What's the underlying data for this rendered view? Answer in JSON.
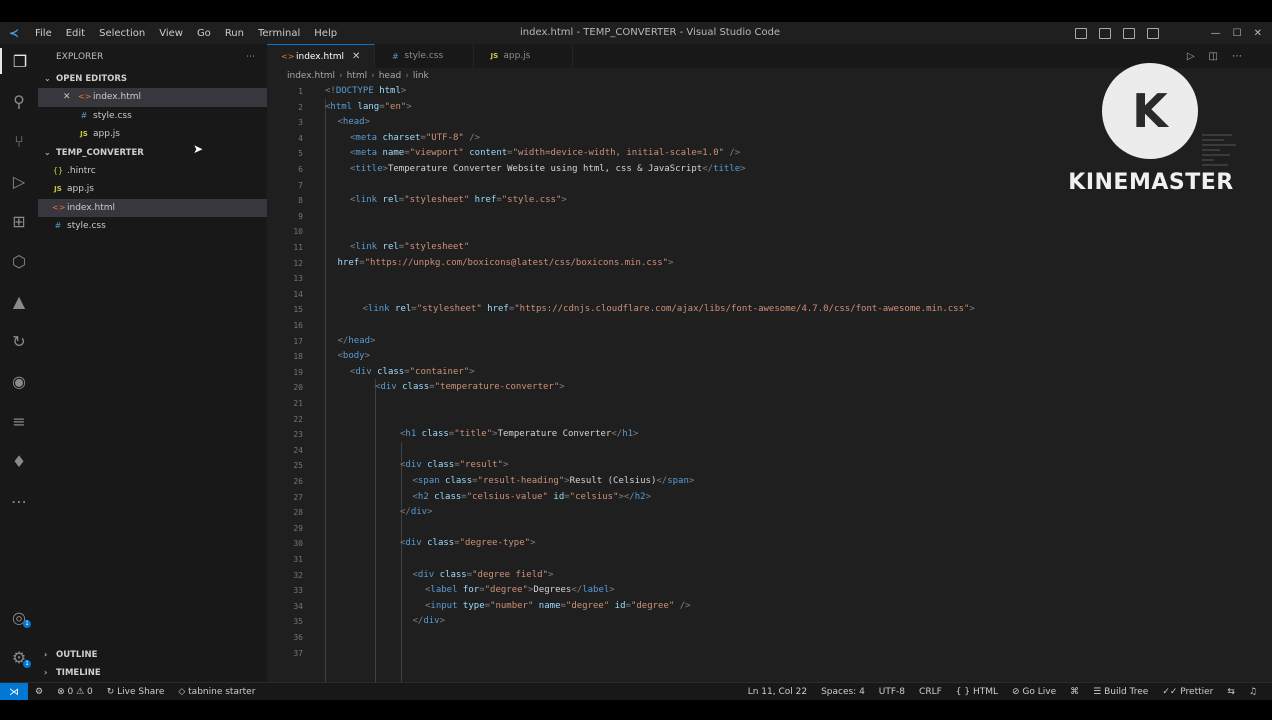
{
  "menu": [
    "File",
    "Edit",
    "Selection",
    "View",
    "Go",
    "Run",
    "Terminal",
    "Help"
  ],
  "window_title": "index.html - TEMP_CONVERTER - Visual Studio Code",
  "sidebar": {
    "title": "EXPLORER",
    "open_editors_title": "OPEN EDITORS",
    "open_editors": [
      "index.html",
      "style.css",
      "app.js"
    ],
    "folder_title": "TEMP_CONVERTER",
    "files": [
      ".hintrc",
      "app.js",
      "index.html",
      "style.css"
    ],
    "outline_title": "OUTLINE",
    "timeline_title": "TIMELINE"
  },
  "tabs": [
    {
      "label": "index.html",
      "active": true
    },
    {
      "label": "style.css",
      "active": false
    },
    {
      "label": "app.js",
      "active": false
    }
  ],
  "breadcrumb": [
    "index.html",
    "html",
    "head",
    "link"
  ],
  "code_lines": [
    {
      "n": "1",
      "indent": 0,
      "parts": [
        [
          "p",
          "<!"
        ],
        [
          "t",
          "DOCTYPE"
        ],
        [
          "a",
          " html"
        ],
        [
          "p",
          ">"
        ]
      ]
    },
    {
      "n": "2",
      "indent": 0,
      "parts": [
        [
          "p",
          "<"
        ],
        [
          "t",
          "html"
        ],
        [
          "a",
          " lang"
        ],
        [
          "p",
          "="
        ],
        [
          "s",
          "\"en\""
        ],
        [
          "p",
          ">"
        ]
      ]
    },
    {
      "n": "3",
      "indent": 1,
      "parts": [
        [
          "p",
          "<"
        ],
        [
          "t",
          "head"
        ],
        [
          "p",
          ">"
        ]
      ]
    },
    {
      "n": "4",
      "indent": 2,
      "parts": [
        [
          "p",
          "<"
        ],
        [
          "t",
          "meta"
        ],
        [
          "a",
          " charset"
        ],
        [
          "p",
          "="
        ],
        [
          "s",
          "\"UTF-8\""
        ],
        [
          "p",
          " />"
        ]
      ]
    },
    {
      "n": "5",
      "indent": 2,
      "parts": [
        [
          "p",
          "<"
        ],
        [
          "t",
          "meta"
        ],
        [
          "a",
          " name"
        ],
        [
          "p",
          "="
        ],
        [
          "s",
          "\"viewport\""
        ],
        [
          "a",
          " content"
        ],
        [
          "p",
          "="
        ],
        [
          "s",
          "\"width=device-width, initial-scale=1.0\""
        ],
        [
          "p",
          " />"
        ]
      ]
    },
    {
      "n": "6",
      "indent": 2,
      "parts": [
        [
          "p",
          "<"
        ],
        [
          "t",
          "title"
        ],
        [
          "p",
          ">"
        ],
        [
          "x",
          "Temperature Converter Website using html, css & JavaScript"
        ],
        [
          "p",
          "</"
        ],
        [
          "t",
          "title"
        ],
        [
          "p",
          ">"
        ]
      ]
    },
    {
      "n": "7",
      "indent": 0,
      "parts": []
    },
    {
      "n": "8",
      "indent": 2,
      "parts": [
        [
          "p",
          "<"
        ],
        [
          "t",
          "link"
        ],
        [
          "a",
          " rel"
        ],
        [
          "p",
          "="
        ],
        [
          "s",
          "\"stylesheet\""
        ],
        [
          "a",
          " href"
        ],
        [
          "p",
          "="
        ],
        [
          "s",
          "\"style.css\""
        ],
        [
          "p",
          ">"
        ]
      ]
    },
    {
      "n": "9",
      "indent": 0,
      "parts": []
    },
    {
      "n": "10",
      "indent": 0,
      "parts": []
    },
    {
      "n": "11",
      "indent": 2,
      "parts": [
        [
          "p",
          "<"
        ],
        [
          "t",
          "link"
        ],
        [
          "a",
          " rel"
        ],
        [
          "p",
          "="
        ],
        [
          "s",
          "\"stylesheet\""
        ]
      ]
    },
    {
      "n": "12",
      "indent": 1,
      "parts": [
        [
          "a",
          "href"
        ],
        [
          "p",
          "="
        ],
        [
          "s",
          "\"https://unpkg.com/boxicons@latest/css/boxicons.min.css\""
        ],
        [
          "p",
          ">"
        ]
      ]
    },
    {
      "n": "13",
      "indent": 0,
      "parts": []
    },
    {
      "n": "14",
      "indent": 0,
      "parts": []
    },
    {
      "n": "15",
      "indent": 3,
      "parts": [
        [
          "p",
          "<"
        ],
        [
          "t",
          "link"
        ],
        [
          "a",
          " rel"
        ],
        [
          "p",
          "="
        ],
        [
          "s",
          "\"stylesheet\""
        ],
        [
          "a",
          " href"
        ],
        [
          "p",
          "="
        ],
        [
          "s",
          "\"https://cdnjs.cloudflare.com/ajax/libs/font-awesome/4.7.0/css/font-awesome.min.css\""
        ],
        [
          "p",
          ">"
        ]
      ]
    },
    {
      "n": "16",
      "indent": 0,
      "parts": []
    },
    {
      "n": "17",
      "indent": 1,
      "parts": [
        [
          "p",
          "</"
        ],
        [
          "t",
          "head"
        ],
        [
          "p",
          ">"
        ]
      ]
    },
    {
      "n": "18",
      "indent": 1,
      "parts": [
        [
          "p",
          "<"
        ],
        [
          "t",
          "body"
        ],
        [
          "p",
          ">"
        ]
      ]
    },
    {
      "n": "19",
      "indent": 2,
      "parts": [
        [
          "p",
          "<"
        ],
        [
          "t",
          "div"
        ],
        [
          "a",
          " class"
        ],
        [
          "p",
          "="
        ],
        [
          "s",
          "\"container\""
        ],
        [
          "p",
          ">"
        ]
      ]
    },
    {
      "n": "20",
      "indent": 4,
      "parts": [
        [
          "p",
          "<"
        ],
        [
          "t",
          "div"
        ],
        [
          "a",
          " class"
        ],
        [
          "p",
          "="
        ],
        [
          "s",
          "\"temperature-converter\""
        ],
        [
          "p",
          ">"
        ]
      ]
    },
    {
      "n": "21",
      "indent": 0,
      "parts": []
    },
    {
      "n": "22",
      "indent": 0,
      "parts": []
    },
    {
      "n": "23",
      "indent": 6,
      "parts": [
        [
          "p",
          "<"
        ],
        [
          "t",
          "h1"
        ],
        [
          "a",
          " class"
        ],
        [
          "p",
          "="
        ],
        [
          "s",
          "\"title\""
        ],
        [
          "p",
          ">"
        ],
        [
          "x",
          "Temperature Converter"
        ],
        [
          "p",
          "</"
        ],
        [
          "t",
          "h1"
        ],
        [
          "p",
          ">"
        ]
      ]
    },
    {
      "n": "24",
      "indent": 0,
      "parts": []
    },
    {
      "n": "25",
      "indent": 6,
      "parts": [
        [
          "p",
          "<"
        ],
        [
          "t",
          "div"
        ],
        [
          "a",
          " class"
        ],
        [
          "p",
          "="
        ],
        [
          "s",
          "\"result\""
        ],
        [
          "p",
          ">"
        ]
      ]
    },
    {
      "n": "26",
      "indent": 7,
      "parts": [
        [
          "p",
          "<"
        ],
        [
          "t",
          "span"
        ],
        [
          "a",
          " class"
        ],
        [
          "p",
          "="
        ],
        [
          "s",
          "\"result-heading\""
        ],
        [
          "p",
          ">"
        ],
        [
          "x",
          "Result (Celsius)"
        ],
        [
          "p",
          "</"
        ],
        [
          "t",
          "span"
        ],
        [
          "p",
          ">"
        ]
      ]
    },
    {
      "n": "27",
      "indent": 7,
      "parts": [
        [
          "p",
          "<"
        ],
        [
          "t",
          "h2"
        ],
        [
          "a",
          " class"
        ],
        [
          "p",
          "="
        ],
        [
          "s",
          "\"celsius-value\""
        ],
        [
          "a",
          " id"
        ],
        [
          "p",
          "="
        ],
        [
          "s",
          "\"celsius\""
        ],
        [
          "p",
          "></"
        ],
        [
          "t",
          "h2"
        ],
        [
          "p",
          ">"
        ]
      ]
    },
    {
      "n": "28",
      "indent": 6,
      "parts": [
        [
          "p",
          "</"
        ],
        [
          "t",
          "div"
        ],
        [
          "p",
          ">"
        ]
      ]
    },
    {
      "n": "29",
      "indent": 0,
      "parts": []
    },
    {
      "n": "30",
      "indent": 6,
      "parts": [
        [
          "p",
          "<"
        ],
        [
          "t",
          "div"
        ],
        [
          "a",
          " class"
        ],
        [
          "p",
          "="
        ],
        [
          "s",
          "\"degree-type\""
        ],
        [
          "p",
          ">"
        ]
      ]
    },
    {
      "n": "31",
      "indent": 0,
      "parts": []
    },
    {
      "n": "32",
      "indent": 7,
      "parts": [
        [
          "p",
          "<"
        ],
        [
          "t",
          "div"
        ],
        [
          "a",
          " class"
        ],
        [
          "p",
          "="
        ],
        [
          "s",
          "\"degree field\""
        ],
        [
          "p",
          ">"
        ]
      ]
    },
    {
      "n": "33",
      "indent": 8,
      "parts": [
        [
          "p",
          "<"
        ],
        [
          "t",
          "label"
        ],
        [
          "a",
          " for"
        ],
        [
          "p",
          "="
        ],
        [
          "s",
          "\"degree\""
        ],
        [
          "p",
          ">"
        ],
        [
          "x",
          "Degrees"
        ],
        [
          "p",
          "</"
        ],
        [
          "t",
          "label"
        ],
        [
          "p",
          ">"
        ]
      ]
    },
    {
      "n": "34",
      "indent": 8,
      "parts": [
        [
          "p",
          "<"
        ],
        [
          "t",
          "input"
        ],
        [
          "a",
          " type"
        ],
        [
          "p",
          "="
        ],
        [
          "s",
          "\"number\""
        ],
        [
          "a",
          " name"
        ],
        [
          "p",
          "="
        ],
        [
          "s",
          "\"degree\""
        ],
        [
          "a",
          " id"
        ],
        [
          "p",
          "="
        ],
        [
          "s",
          "\"degree\""
        ],
        [
          "p",
          " />"
        ]
      ]
    },
    {
      "n": "35",
      "indent": 7,
      "parts": [
        [
          "p",
          "</"
        ],
        [
          "t",
          "div"
        ],
        [
          "p",
          ">"
        ]
      ]
    },
    {
      "n": "36",
      "indent": 0,
      "parts": []
    },
    {
      "n": "37",
      "indent": 0,
      "parts": []
    }
  ],
  "watermark": {
    "letter": "K",
    "text": "KINEMASTER"
  },
  "statusbar": {
    "problems": "⊗ 0 ⚠ 0",
    "live_share": "Live Share",
    "tabnine": "tabnine starter",
    "position": "Ln 11, Col 22",
    "spaces": "Spaces: 4",
    "encoding": "UTF-8",
    "eol": "CRLF",
    "language": "HTML",
    "go_live": "Go Live",
    "build_tree": "Build Tree",
    "prettier": "Prettier"
  },
  "colors": {
    "accent": "#0078d4",
    "background": "#1e1e1e"
  }
}
